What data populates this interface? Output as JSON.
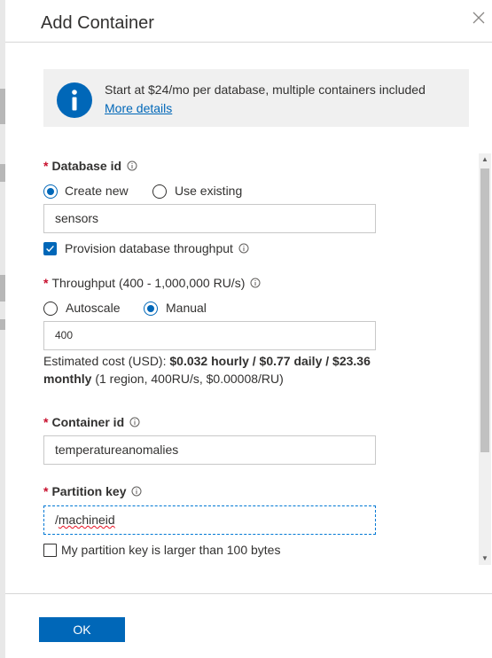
{
  "dialog": {
    "title": "Add Container",
    "close_icon": "close-icon"
  },
  "banner": {
    "message": "Start at $24/mo per database, multiple containers included",
    "link": "More details",
    "icon": "info-icon",
    "icon_color": "#0067b8"
  },
  "database": {
    "label": "Database id",
    "required": "*",
    "options": {
      "create_new": "Create new",
      "use_existing": "Use existing"
    },
    "selected": "create_new",
    "value": "sensors",
    "provision_label": "Provision database throughput",
    "provision_checked": true
  },
  "throughput": {
    "label": "Throughput (400 - 1,000,000 RU/s)",
    "required": "*",
    "options": {
      "autoscale": "Autoscale",
      "manual": "Manual"
    },
    "selected": "manual",
    "value": "400",
    "cost_prefix": "Estimated cost (USD): ",
    "cost_bold": "$0.032 hourly / $0.77 daily / $23.36",
    "cost_bold_2": "monthly",
    "cost_suffix": " (1 region, 400RU/s, $0.00008/RU)"
  },
  "container": {
    "label": "Container id",
    "required": "*",
    "value": "temperatureanomalies"
  },
  "partition": {
    "label": "Partition key",
    "required": "*",
    "value_prefix": "/",
    "value_word": "machineid",
    "large_label": "My partition key is larger than 100 bytes",
    "large_checked": false
  },
  "footer": {
    "ok_label": "OK"
  },
  "colors": {
    "accent": "#0067b8",
    "required": "#c8102e",
    "banner_bg": "#f0f0f0"
  }
}
